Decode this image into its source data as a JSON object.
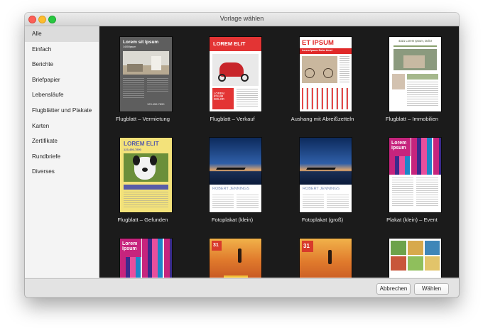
{
  "window": {
    "title": "Vorlage wählen"
  },
  "sidebar": {
    "items": [
      {
        "label": "Alle",
        "selected": true
      },
      {
        "label": "Einfach"
      },
      {
        "label": "Berichte"
      },
      {
        "label": "Briefpapier"
      },
      {
        "label": "Lebensläufe"
      },
      {
        "label": "Flugblätter und Plakate"
      },
      {
        "label": "Karten"
      },
      {
        "label": "Zertifikate"
      },
      {
        "label": "Rundbriefe"
      },
      {
        "label": "Diverses"
      }
    ]
  },
  "templates": [
    {
      "label": "Flugblatt – Vermietung",
      "thumb": {
        "heading": "Lorem sit Ipsum",
        "sub": "1400/Ipsum",
        "phone": "123.456.7890"
      }
    },
    {
      "label": "Flugblatt – Verkauf",
      "thumb": {
        "heading": "LOREM ELIT",
        "footer": "LOREM IPSUM DOLOR"
      }
    },
    {
      "label": "Aushang mit Abreißzetteln",
      "thumb": {
        "heading": "ET IPSUM",
        "sub": "Lorem Ipsum Dolor Amet"
      }
    },
    {
      "label": "Flugblatt – Immobilien",
      "thumb": {
        "heading": "4321 Lorem Ipsum, Dolor"
      }
    },
    {
      "label": "Flugblatt – Gefunden",
      "thumb": {
        "heading": "LOREM ELIT",
        "sub": "123-456-7890"
      }
    },
    {
      "label": "Fotoplakat (klein)",
      "thumb": {
        "heading": "ROBERT JENNINGS"
      }
    },
    {
      "label": "Fotoplakat (groß)",
      "thumb": {
        "heading": "ROBERT JENNINGS"
      }
    },
    {
      "label": "Plakat (klein) – Event",
      "thumb": {
        "heading": "Lorem Ipsum"
      }
    },
    {
      "label": "",
      "thumb": {
        "heading": "Lorem Ipsum"
      }
    },
    {
      "label": "",
      "thumb": {
        "badge": "31"
      }
    },
    {
      "label": "",
      "thumb": {
        "badge": "31"
      }
    },
    {
      "label": "",
      "thumb": {}
    }
  ],
  "footer": {
    "cancel_label": "Abbrechen",
    "choose_label": "Wählen"
  }
}
